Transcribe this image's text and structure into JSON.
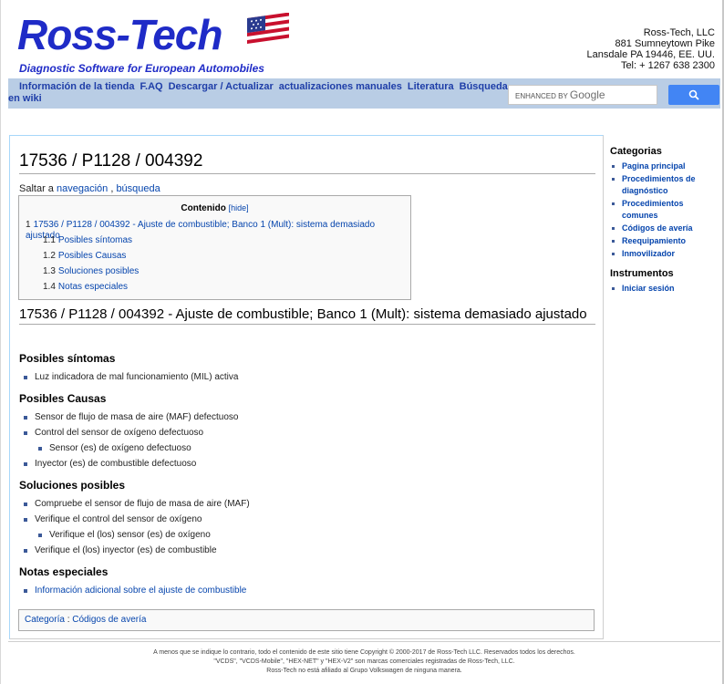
{
  "header": {
    "logo_text": "Ross-Tech",
    "tagline": "Diagnostic Software for European Automobiles",
    "address": [
      "Ross-Tech, LLC",
      "881 Sumneytown Pike",
      "Lansdale PA 19446, EE. UU.",
      "Tel: + 1267 638 2300"
    ]
  },
  "nav": {
    "links": [
      "Información de la tienda",
      "F.AQ",
      "Descargar / Actualizar",
      "actualizaciones manuales",
      "Literatura",
      "Búsqueda en wiki"
    ],
    "search_label_small": "ENHANCED BY",
    "search_label_google": "Google",
    "search_button_icon": "search-icon"
  },
  "page": {
    "title": "17536 / P1128 / 004392",
    "jump_prefix": "Saltar a",
    "jump_nav": "navegación",
    "jump_sep": " , ",
    "jump_search": "búsqueda",
    "toc": {
      "title": "Contenido",
      "hide": "[hide]",
      "items": [
        {
          "num": "1",
          "label": "17536 / P1128 / 004392 - Ajuste de combustible; Banco 1 (Mult): sistema demasiado ajustado"
        },
        {
          "num": "1.1",
          "label": "Posibles síntomas"
        },
        {
          "num": "1.2",
          "label": "Posibles Causas"
        },
        {
          "num": "1.3",
          "label": "Soluciones posibles"
        },
        {
          "num": "1.4",
          "label": "Notas especiales"
        }
      ]
    },
    "heading": "17536 / P1128 / 004392 - Ajuste de combustible; Banco 1 (Mult): sistema demasiado ajustado",
    "sections": {
      "sintomas": {
        "title": "Posibles síntomas",
        "items": [
          "Luz indicadora de mal funcionamiento (MIL) activa"
        ]
      },
      "causas": {
        "title": "Posibles Causas",
        "items": [
          "Sensor de flujo de masa de aire (MAF) defectuoso",
          "Control del sensor de oxígeno defectuoso",
          "Sensor (es) de oxígeno defectuoso",
          "Inyector (es) de combustible defectuoso"
        ]
      },
      "soluciones": {
        "title": "Soluciones posibles",
        "items": [
          "Compruebe el sensor de flujo de masa de aire (MAF)",
          "Verifique el control del sensor de oxígeno",
          "Verifique el (los) sensor (es) de oxígeno",
          "Verifique el (los) inyector (es) de combustible"
        ]
      },
      "notas": {
        "title": "Notas especiales",
        "items": [
          "Información adicional sobre el ajuste de combustible"
        ]
      }
    },
    "category_prefix": "Categoría",
    "category_sep": " : ",
    "category": "Códigos de avería"
  },
  "sidebar": {
    "categorias_title": "Categorias",
    "categorias": [
      "Pagina principal",
      "Procedimientos de diagnóstico",
      "Procedimientos comunes",
      "Códigos de avería",
      "Reequipamiento",
      "Inmovilizador"
    ],
    "instrumentos_title": "Instrumentos",
    "instrumentos": [
      "Iniciar sesión"
    ]
  },
  "footer": {
    "lines": [
      "A menos que se indique lo contrario, todo el contenido de este sitio tiene Copyright © 2000-2017 de Ross-Tech LLC. Reservados todos los derechos.",
      "\"VCDS\", \"VCDS-Mobile\", \"HEX-NET\" y \"HEX-V2\" son marcas comerciales registradas de Ross-Tech, LLC.",
      "Ross-Tech no está afiliado al Grupo Volkswagen de ninguna manera."
    ]
  },
  "colors": {
    "brand_blue": "#1f2bc7",
    "nav_bg": "#b9cde5",
    "link": "#0645ad",
    "search_button": "#4285f4"
  }
}
